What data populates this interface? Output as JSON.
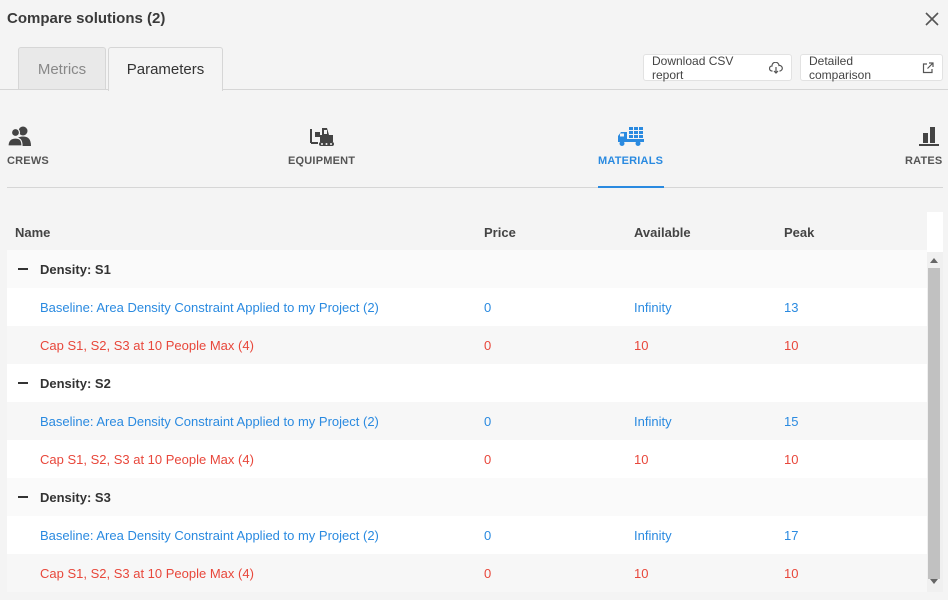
{
  "dialog": {
    "title": "Compare solutions (2)"
  },
  "tabs": {
    "metrics": "Metrics",
    "parameters": "Parameters"
  },
  "buttons": {
    "csv": "Download CSV report",
    "detailed": "Detailed comparison"
  },
  "categories": {
    "crews": "CREWS",
    "equipment": "EQUIPMENT",
    "materials": "MATERIALS",
    "rates": "RATES"
  },
  "active_category": "MATERIALS",
  "columns": {
    "name": "Name",
    "price": "Price",
    "available": "Available",
    "peak": "Peak"
  },
  "groups": [
    {
      "label": "Density: S1",
      "rows": [
        {
          "name": "Baseline: Area Density Constraint Applied to my Project (2)",
          "price": "0",
          "available": "Infinity",
          "peak": "13"
        },
        {
          "name": "Cap S1, S2, S3 at 10 People Max (4)",
          "price": "0",
          "available": "10",
          "peak": "10"
        }
      ]
    },
    {
      "label": "Density: S2",
      "rows": [
        {
          "name": "Baseline: Area Density Constraint Applied to my Project (2)",
          "price": "0",
          "available": "Infinity",
          "peak": "15"
        },
        {
          "name": "Cap S1, S2, S3 at 10 People Max (4)",
          "price": "0",
          "available": "10",
          "peak": "10"
        }
      ]
    },
    {
      "label": "Density: S3",
      "rows": [
        {
          "name": "Baseline: Area Density Constraint Applied to my Project (2)",
          "price": "0",
          "available": "Infinity",
          "peak": "17"
        },
        {
          "name": "Cap S1, S2, S3 at 10 People Max (4)",
          "price": "0",
          "available": "10",
          "peak": "10"
        }
      ]
    }
  ],
  "colors": {
    "accent": "#2a8ae0",
    "baseline": "#2a8ae0",
    "cap": "#e8473b"
  }
}
